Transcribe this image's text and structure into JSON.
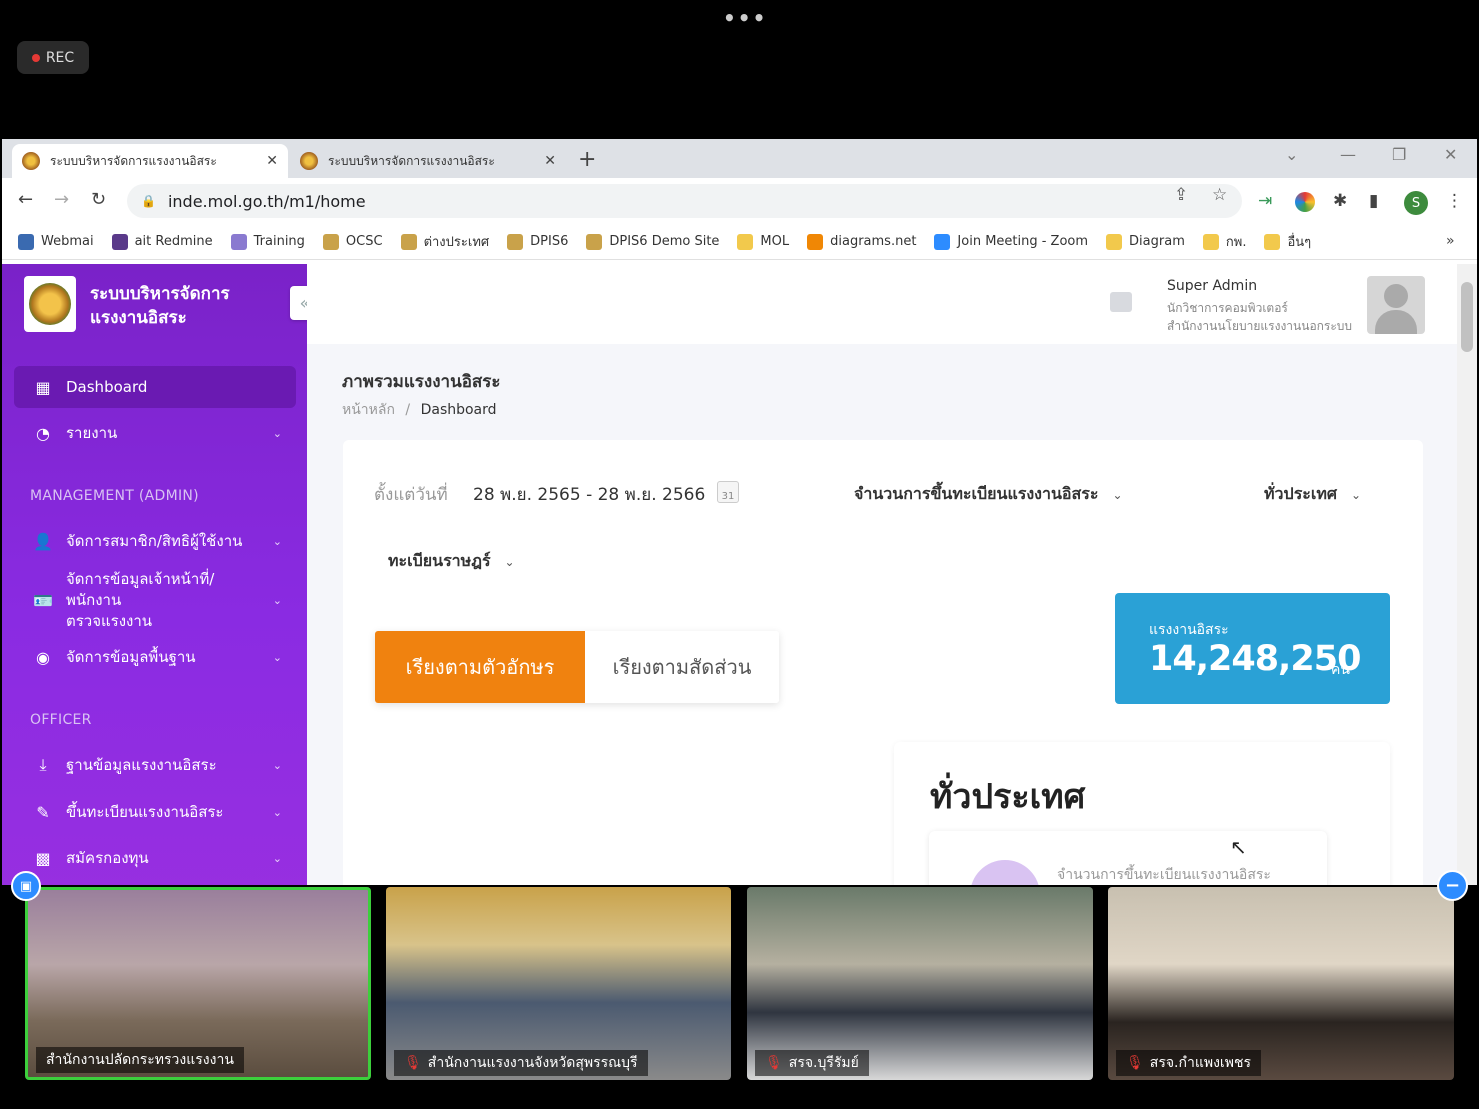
{
  "zoom": {
    "rec_label": "REC",
    "participants": [
      {
        "name": "สำนักงานปลัดกระทรวงแรงงาน",
        "muted": false
      },
      {
        "name": "สำนักงานแรงงานจังหวัดสุพรรณบุรี",
        "muted": true
      },
      {
        "name": "สรจ.บุรีรัมย์",
        "muted": true
      },
      {
        "name": "สรจ.กำแพงเพชร",
        "muted": true
      }
    ]
  },
  "browser": {
    "tabs": [
      {
        "title": "ระบบบริหารจัดการแรงงานอิสระ",
        "active": true
      },
      {
        "title": "ระบบบริหารจัดการแรงงานอิสระ",
        "active": false
      }
    ],
    "url": "inde.mol.go.th/m1/home",
    "profile_initial": "S",
    "bookmarks": [
      {
        "label": "Webmai",
        "color": "#3a6ab0"
      },
      {
        "label": "ait Redmine",
        "color": "#5a3a8a"
      },
      {
        "label": "Training",
        "color": "#8a7ad0"
      },
      {
        "label": "OCSC",
        "color": "#c9a24a"
      },
      {
        "label": "ต่างประเทศ",
        "color": "#c9a24a"
      },
      {
        "label": "DPIS6",
        "color": "#c9a24a"
      },
      {
        "label": "DPIS6 Demo Site",
        "color": "#c9a24a"
      },
      {
        "label": "MOL",
        "color": "#f2c94c"
      },
      {
        "label": "diagrams.net",
        "color": "#f08705"
      },
      {
        "label": "Join Meeting - Zoom",
        "color": "#2d8cff"
      },
      {
        "label": "Diagram",
        "color": "#f2c94c"
      },
      {
        "label": "กพ.",
        "color": "#f2c94c"
      },
      {
        "label": "อื่นๆ",
        "color": "#f2c94c"
      }
    ]
  },
  "app": {
    "brand_line1": "ระบบบริหารจัดการ",
    "brand_line2": "แรงงานอิสระ",
    "nav": [
      {
        "label": "Dashboard",
        "icon": "dashboard-icon",
        "active": true
      },
      {
        "label": "รายงาน",
        "icon": "pie-chart-icon"
      }
    ],
    "section_admin": "MANAGEMENT (ADMIN)",
    "admin_items": [
      {
        "label": "จัดการสมาชิก/สิทธิผู้ใช้งาน",
        "icon": "user-icon"
      },
      {
        "label": "จัดการข้อมูลเจ้าหน้าที่/พนักงาน",
        "label2": "ตรวจแรงงาน",
        "icon": "id-card-icon"
      },
      {
        "label": "จัดการข้อมูลพื้นฐาน",
        "icon": "target-icon"
      }
    ],
    "section_officer": "OFFICER",
    "officer_items": [
      {
        "label": "ฐานข้อมูลแรงงานอิสระ",
        "icon": "download-icon"
      },
      {
        "label": "ขึ้นทะเบียนแรงงานอิสระ",
        "icon": "edit-icon"
      },
      {
        "label": "สมัครกองทุน",
        "icon": "image-icon"
      }
    ],
    "user": {
      "name": "Super Admin",
      "role": "นักวิชาการคอมพิวเตอร์",
      "org": "สำนักงานนโยบายแรงงานนอกระบบ"
    },
    "page_title": "ภาพรวมแรงงานอิสระ",
    "breadcrumb_home": "หน้าหลัก",
    "breadcrumb_sep": "/",
    "breadcrumb_current": "Dashboard",
    "filters": {
      "date_label": "ตั้งแต่วันที่",
      "date_range": "28 พ.ย. 2565 - 28 พ.ย. 2566",
      "calendar_day": "31",
      "metric": "จำนวนการขึ้นทะเบียนแรงงานอิสระ",
      "region": "ทั่วประเทศ",
      "source": "ทะเบียนราษฎร์"
    },
    "sort_alpha": "เรียงตามตัวอักษร",
    "sort_ratio": "เรียงตามสัดส่วน",
    "stat": {
      "label": "แรงงานอิสระ",
      "value": "14,248,250",
      "unit": "คน"
    },
    "region_title": "ทั่วประเทศ",
    "region_sub": "จำนวนการขึ้นทะเบียนแรงงานอิสระ"
  }
}
